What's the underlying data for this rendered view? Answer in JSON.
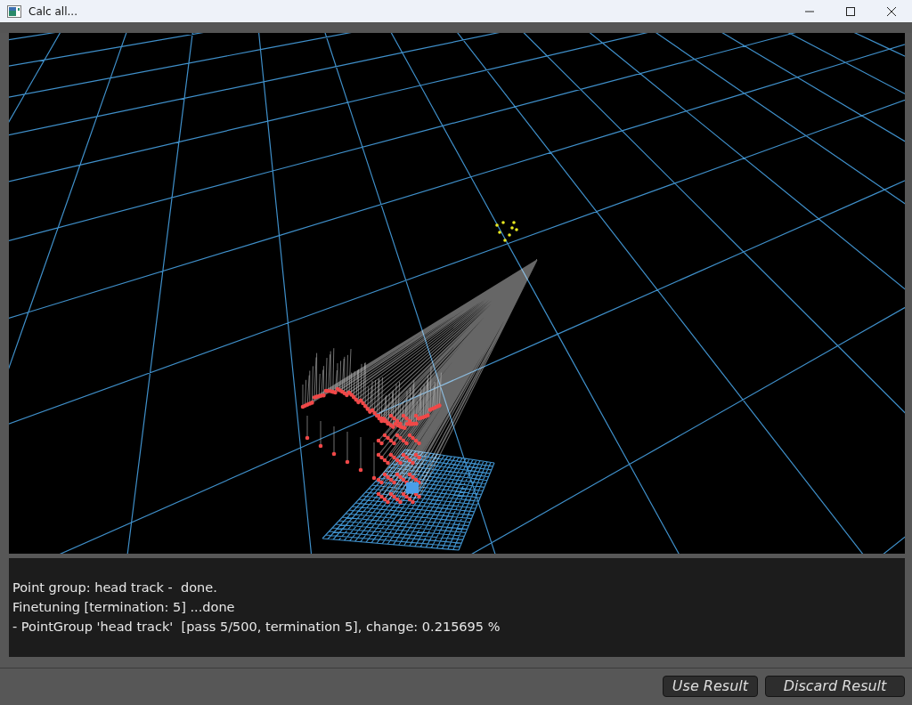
{
  "window": {
    "title": "Calc all..."
  },
  "log": [
    "Point group: head track -  done.",
    "Finetuning [termination: 5] ...done",
    "- PointGroup 'head track'  [pass 5/500, termination 5], change: 0.215695 %"
  ],
  "buttons": [
    "Use Result",
    "Discard Result"
  ]
}
